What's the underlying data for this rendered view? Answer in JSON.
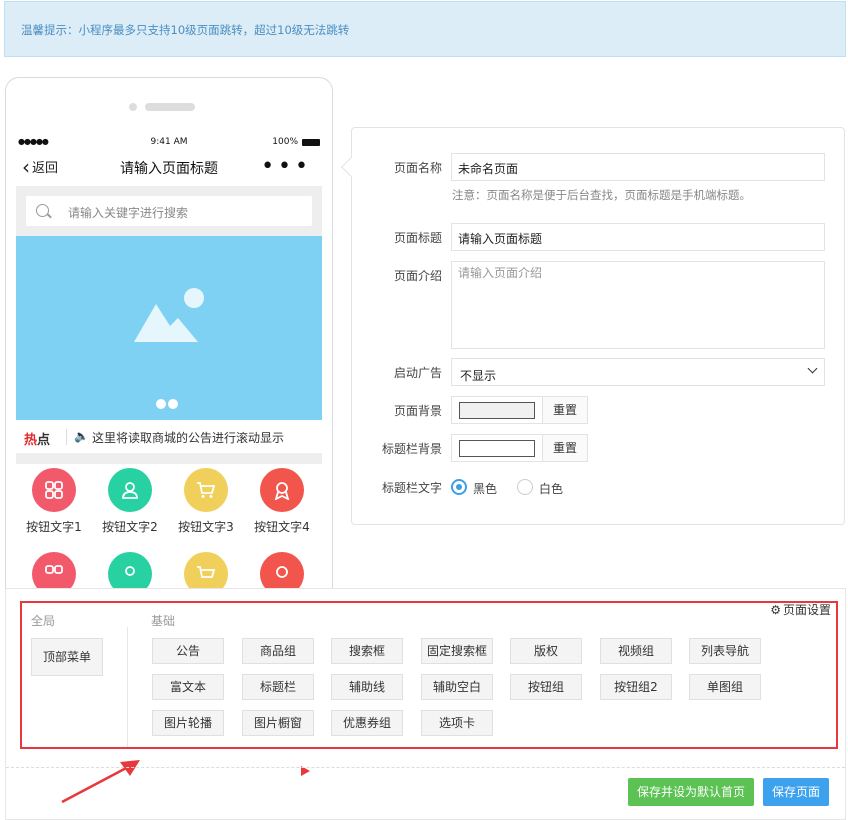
{
  "tip": "温馨提示：小程序最多只支持10级页面跳转，超过10级无法跳转",
  "phone": {
    "status": {
      "signal": "●●●●● ",
      "time": "9:41 AM",
      "battery": "100%"
    },
    "nav": {
      "back_label": "返回",
      "title": "请输入页面标题",
      "more": "•••"
    },
    "search_placeholder": "请输入关键字进行搜索",
    "notice": {
      "hot_red": "热",
      "hot_dark": "点",
      "text": "这里将读取商城的公告进行滚动显示"
    },
    "buttons": [
      {
        "label": "按钮文字1",
        "color": "#f25a6b",
        "icon": "grid-icon"
      },
      {
        "label": "按钮文字2",
        "color": "#27d1a1",
        "icon": "user-icon"
      },
      {
        "label": "按钮文字3",
        "color": "#f0cf5a",
        "icon": "cart-icon"
      },
      {
        "label": "按钮文字4",
        "color": "#f2554c",
        "icon": "badge-icon"
      }
    ]
  },
  "form": {
    "page_name_label": "页面名称",
    "page_name_value": "未命名页面",
    "note": "注意：页面名称是便于后台查找，页面标题是手机端标题。",
    "page_title_label": "页面标题",
    "page_title_value": "请输入页面标题",
    "page_intro_label": "页面介绍",
    "page_intro_placeholder": "请输入页面介绍",
    "ad_label": "启动广告",
    "ad_value": "不显示",
    "bg_label": "页面背景",
    "bg_reset": "重置",
    "titlebar_bg_label": "标题栏背景",
    "titlebar_bg_reset": "重置",
    "titlebar_text_label": "标题栏文字",
    "radio_black": "黑色",
    "radio_white": "白色"
  },
  "panel": {
    "settings_label": "页面设置",
    "global_label": "全局",
    "basic_label": "基础",
    "global_items": [
      "顶部菜单"
    ],
    "basic_rows": [
      [
        "公告",
        "商品组",
        "搜索框",
        "固定搜索框",
        "版权",
        "视频组",
        "列表导航"
      ],
      [
        "富文本",
        "标题栏",
        "辅助线",
        "辅助空白",
        "按钮组",
        "按钮组2",
        "单图组"
      ],
      [
        "图片轮播",
        "图片橱窗",
        "优惠券组",
        "选项卡"
      ]
    ],
    "save_default": "保存并设为默认首页",
    "save": "保存页面"
  },
  "colors": {
    "accent_blue": "#3da2ee",
    "green": "#5cc254",
    "red": "#e8383d",
    "banner": "#7fd1f4"
  }
}
